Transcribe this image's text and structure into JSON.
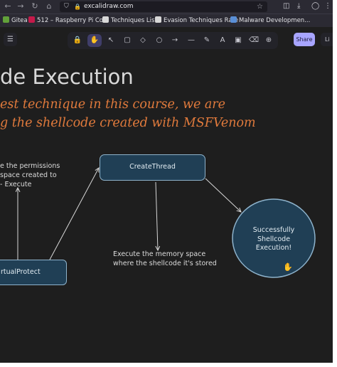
{
  "browser": {
    "url": "excalidraw.com",
    "bookmarks": [
      {
        "label": "Gitea",
        "color": "#62a13a"
      },
      {
        "label": "512 – Raspberry Pi Co...",
        "color": "#c51a4a"
      },
      {
        "label": "Techniques List",
        "color": "#d8d8d8"
      },
      {
        "label": "Evasion Techniques Rate",
        "color": "#d8d8d8"
      },
      {
        "label": "Malware Developmen...",
        "color": "#5a8fd6"
      }
    ]
  },
  "toolbar": {
    "tools": [
      {
        "icon": "lock-icon",
        "glyph": "🔒",
        "key": ""
      },
      {
        "icon": "hand-icon",
        "glyph": "✋",
        "key": ""
      },
      {
        "icon": "selection-icon",
        "glyph": "↖",
        "key": "1"
      },
      {
        "icon": "rectangle-icon",
        "glyph": "▢",
        "key": "2"
      },
      {
        "icon": "diamond-icon",
        "glyph": "◇",
        "key": "3"
      },
      {
        "icon": "ellipse-icon",
        "glyph": "○",
        "key": "4"
      },
      {
        "icon": "arrow-icon",
        "glyph": "→",
        "key": "5"
      },
      {
        "icon": "line-icon",
        "glyph": "—",
        "key": "6"
      },
      {
        "icon": "pencil-icon",
        "glyph": "✎",
        "key": "7"
      },
      {
        "icon": "text-icon",
        "glyph": "A",
        "key": "8"
      },
      {
        "icon": "image-icon",
        "glyph": "▣",
        "key": "9"
      },
      {
        "icon": "eraser-icon",
        "glyph": "⌫",
        "key": "0"
      },
      {
        "icon": "more-tools-icon",
        "glyph": "⊕",
        "key": ""
      }
    ],
    "active_tool": "hand-icon",
    "share_label": "Share",
    "library_label": "Li"
  },
  "canvas": {
    "heading": "de Execution",
    "subtitle_line1": "est technique in this course, we are",
    "subtitle_line2": "g the shellcode created with MSFVenom",
    "note_permissions": [
      "e the permissions",
      "space created to",
      "- Execute"
    ],
    "node_createthread": "CreateThread",
    "node_virtualprotect": "rtualProtect",
    "node_success": [
      "Successfully",
      "Shellcode",
      "Execution!"
    ],
    "note_execute": [
      "Execute the memory space",
      "where the shellcode it's stored"
    ]
  },
  "colors": {
    "canvas_bg": "#1e1e1e",
    "node_fill": "#203f55",
    "node_stroke": "#8eb3cc",
    "handwritten": "#e07a3c",
    "accent": "#a8a5ff"
  }
}
